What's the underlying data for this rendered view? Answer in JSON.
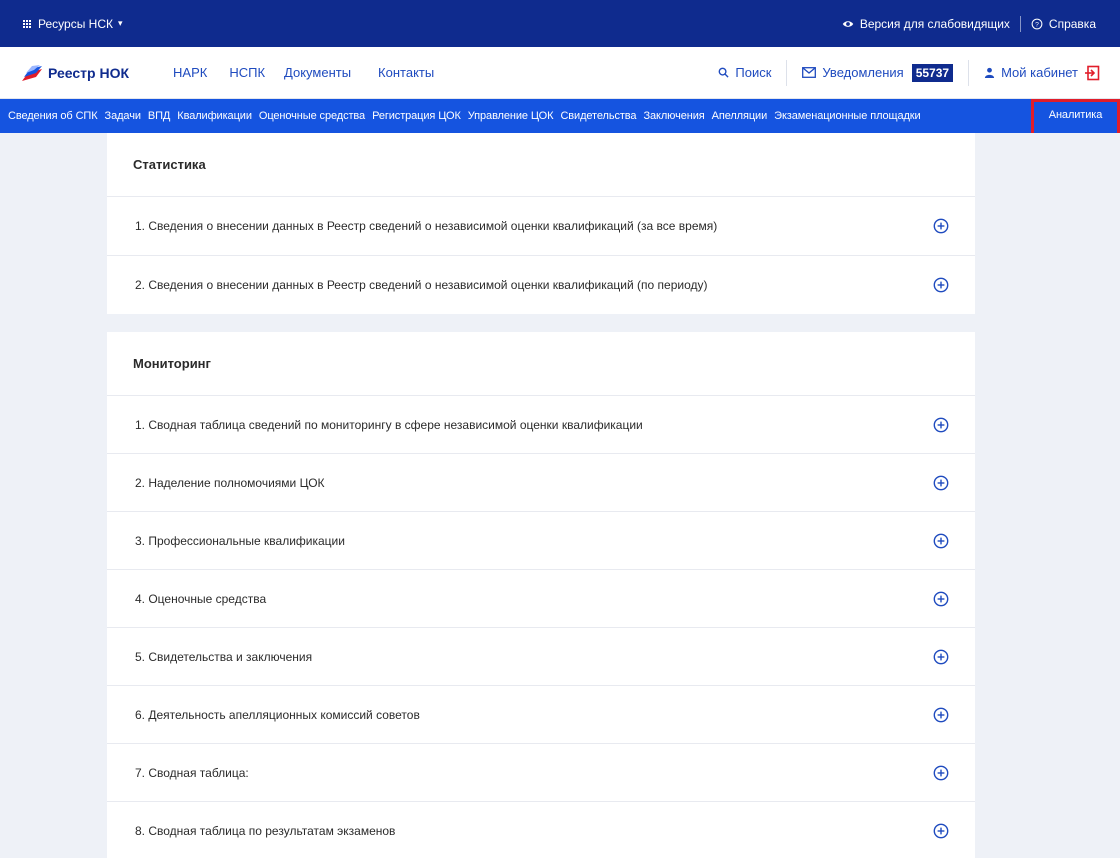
{
  "topbar": {
    "resources_label": "Ресурсы НСК",
    "vision_label": "Версия для слабовидящих",
    "help_label": "Справка"
  },
  "header": {
    "logo_text": "Реестр НОК",
    "nav": [
      "НАРК",
      "НСПК",
      "Документы",
      "Контакты"
    ],
    "search_label": "Поиск",
    "notifications_label": "Уведомления",
    "notifications_count": "55737",
    "cabinet_label": "Мой кабинет"
  },
  "subnav": {
    "items": [
      "Сведения об СПК",
      "Задачи",
      "ВПД",
      "Квалификации",
      "Оценочные средства",
      "Регистрация ЦОК",
      "Управление ЦОК",
      "Свидетельства",
      "Заключения",
      "Апелляции",
      "Экзаменационные площадки"
    ],
    "active": "Аналитика"
  },
  "colors": {
    "topbar": "#0f2b8e",
    "subnav": "#1554e0",
    "link": "#1f4bbf",
    "highlight": "#e11d2a",
    "background": "#eef1f7"
  },
  "statistics": {
    "title": "Статистика",
    "rows": [
      "1. Сведения о внесении данных в Реестр сведений о независимой оценки квалификаций (за все время)",
      "2. Сведения о внесении данных в Реестр сведений о независимой оценки квалификаций (по периоду)"
    ]
  },
  "monitoring": {
    "title": "Мониторинг",
    "rows": [
      "1. Сводная таблица сведений по мониторингу в сфере независимой оценки квалификации",
      "2. Наделение полномочиями ЦОК",
      "3. Профессиональные квалификации",
      "4. Оценочные средства",
      "5. Свидетельства и заключения",
      "6. Деятельность апелляционных комиссий советов",
      "7. Сводная таблица:",
      "8. Сводная таблица по результатам экзаменов"
    ]
  }
}
